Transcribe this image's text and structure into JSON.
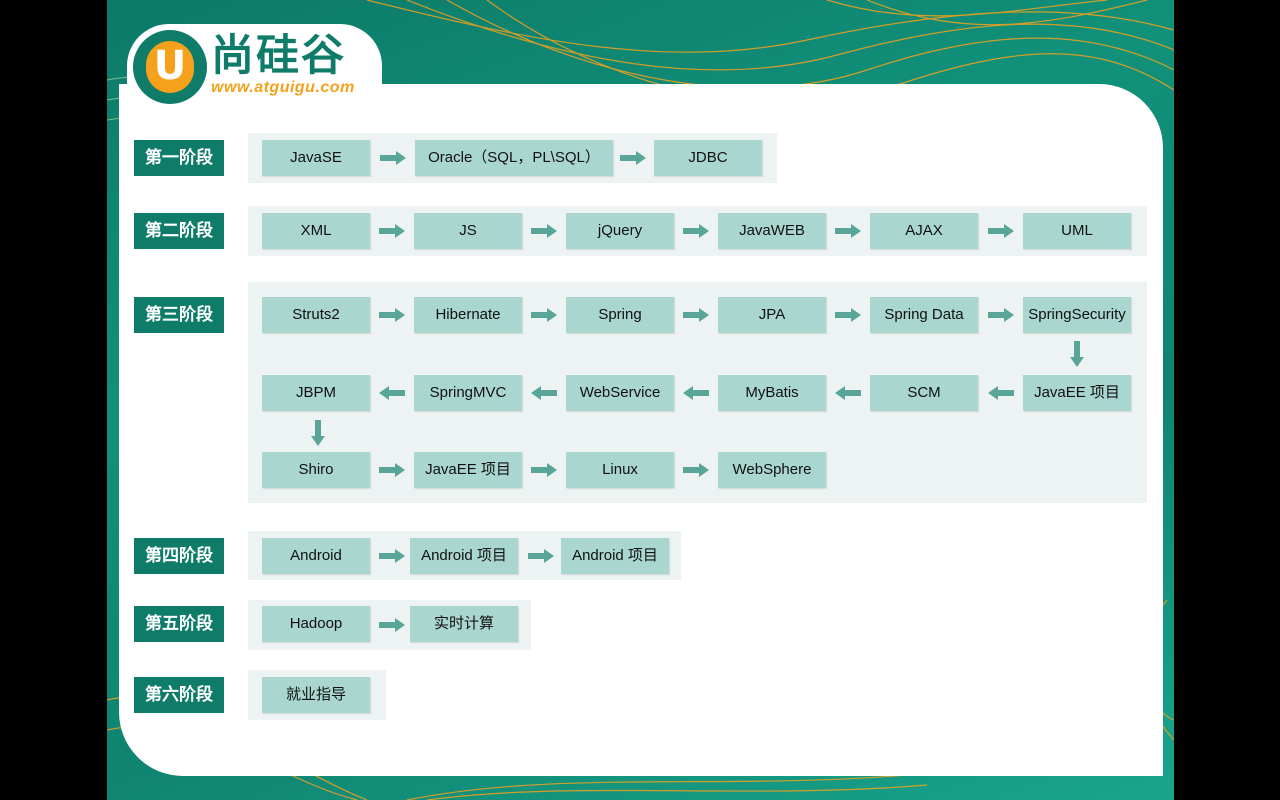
{
  "logo": {
    "letter": "U",
    "name": "尚硅谷",
    "url": "www.atguigu.com"
  },
  "colors": {
    "brand_teal": "#0f7c6a",
    "brand_orange": "#f5a11c",
    "node_fill": "#a9d6cf",
    "arrow": "#5aa59a",
    "group_bg": "#edf3f2"
  },
  "stages": [
    {
      "label": "第一阶段",
      "nodes": [
        "JavaSE",
        "Oracle（SQL，PL\\SQL）",
        "JDBC"
      ]
    },
    {
      "label": "第二阶段",
      "nodes": [
        "XML",
        "JS",
        "jQuery",
        "JavaWEB",
        "AJAX",
        "UML"
      ]
    },
    {
      "label": "第三阶段",
      "nodes": [
        "Struts2",
        "Hibernate",
        "Spring",
        "JPA",
        "Spring Data",
        "SpringSecurity",
        "JavaEE 项目",
        "SCM",
        "MyBatis",
        "WebService",
        "SpringMVC",
        "JBPM",
        "Shiro",
        "JavaEE 项目",
        "Linux",
        "WebSphere"
      ]
    },
    {
      "label": "第四阶段",
      "nodes": [
        "Android",
        "Android 项目",
        "Android 项目"
      ]
    },
    {
      "label": "第五阶段",
      "nodes": [
        "Hadoop",
        "实时计算"
      ]
    },
    {
      "label": "第六阶段",
      "nodes": [
        "就业指导"
      ]
    }
  ]
}
